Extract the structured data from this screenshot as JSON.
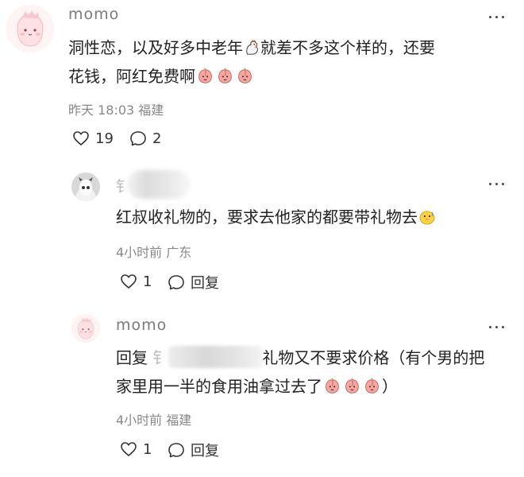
{
  "comment1": {
    "username": "momo",
    "text_a": "洞性恋，以及好多中老年",
    "text_b": "就差不多这个样的，还要",
    "text_c": "花钱，阿红免费啊",
    "time": "昨天 18:03",
    "location": "福建",
    "likes": "19",
    "replies": "2",
    "emoji_names": [
      "rooster-emoji",
      "peach-face-emoji"
    ]
  },
  "reply1": {
    "username_fragment": "钅",
    "text": "红叔收礼物的，要求去他家的都要带礼物去",
    "time": "4小时前",
    "location": "广东",
    "likes": "1",
    "reply_label": "回复"
  },
  "reply2": {
    "username": "momo",
    "text_prefix": "回复",
    "blur_fragment": "钅",
    "text_a": "礼物又不要求价格（有个男的把",
    "text_b": "家里用一半的食用油拿过去了",
    "text_c": "）",
    "time": "4小时前",
    "location": "福建",
    "likes": "1",
    "reply_label": "回复"
  },
  "colors": {
    "text": "#222222",
    "meta": "#888888",
    "avatar_pink": "#f9cfd3"
  }
}
